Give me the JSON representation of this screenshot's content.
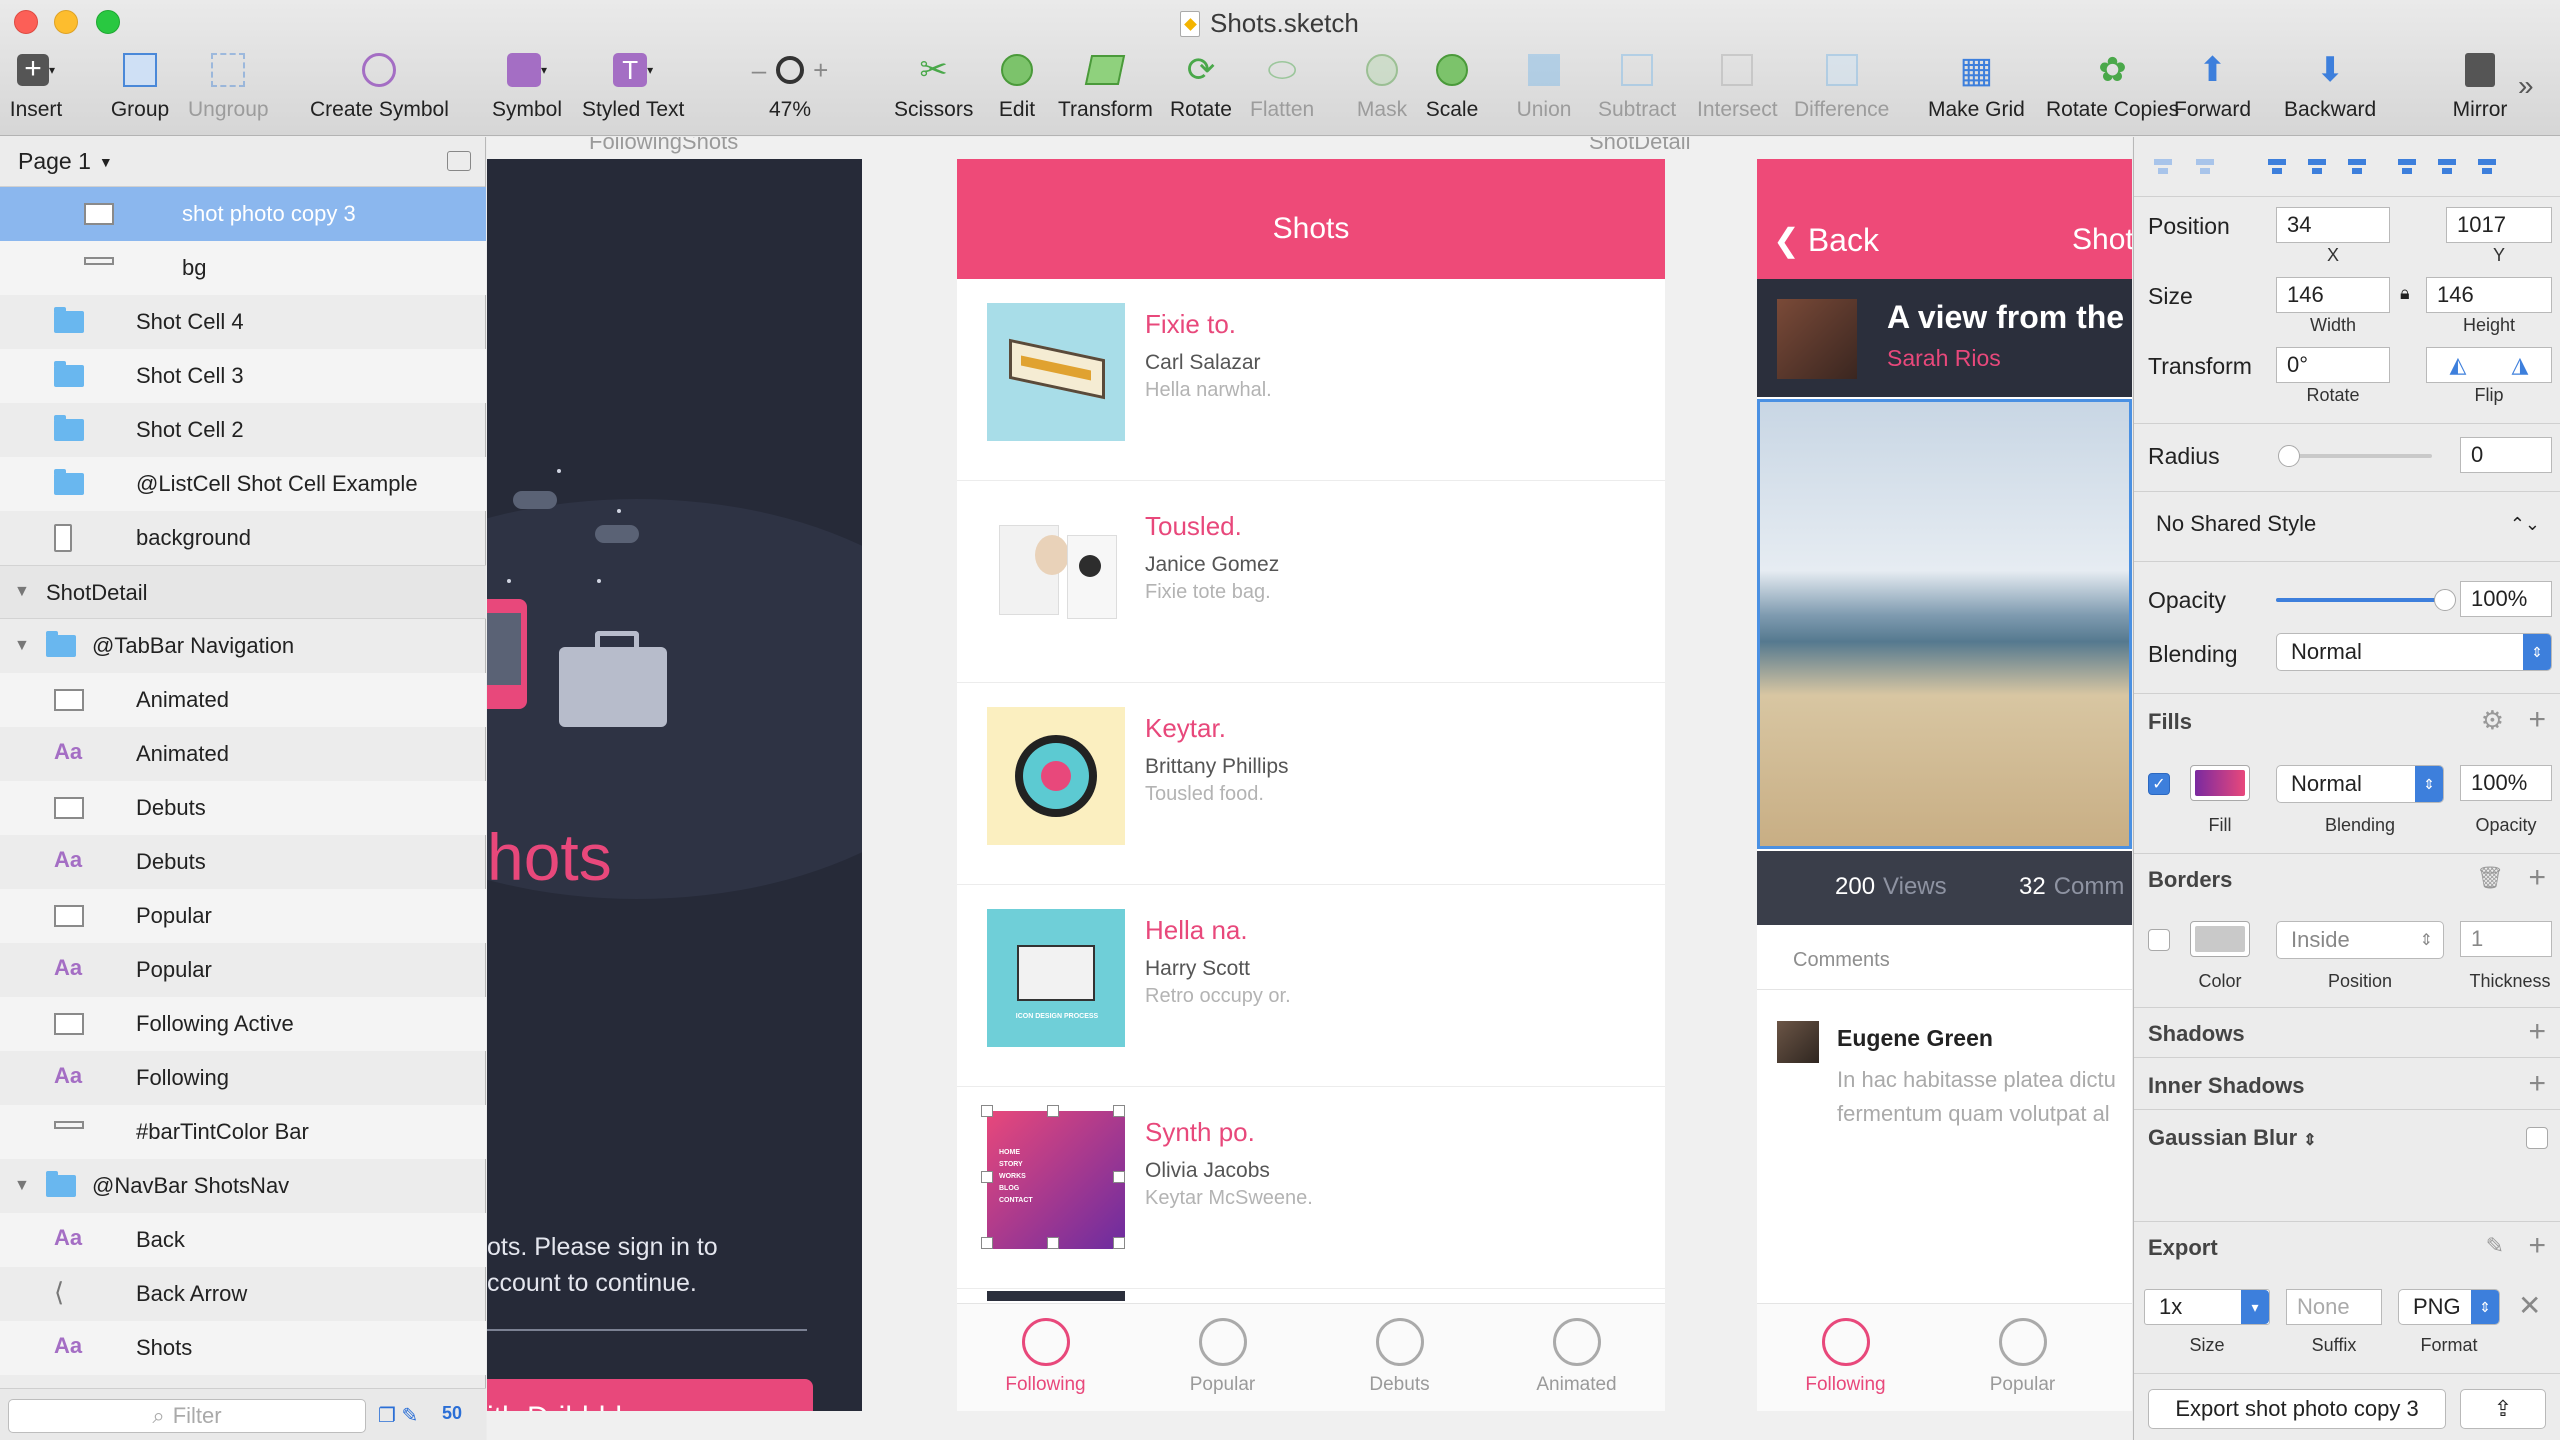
{
  "window": {
    "title": "Shots.sketch"
  },
  "toolbar": {
    "insert": "Insert",
    "group": "Group",
    "ungroup": "Ungroup",
    "create_symbol": "Create Symbol",
    "symbol": "Symbol",
    "styled_text": "Styled Text",
    "zoom": "47%",
    "scissors": "Scissors",
    "edit": "Edit",
    "transform": "Transform",
    "rotate": "Rotate",
    "flatten": "Flatten",
    "mask": "Mask",
    "scale": "Scale",
    "union": "Union",
    "subtract": "Subtract",
    "intersect": "Intersect",
    "difference": "Difference",
    "make_grid": "Make Grid",
    "rotate_copies": "Rotate Copies",
    "forward": "Forward",
    "backward": "Backward",
    "mirror": "Mirror"
  },
  "layers": {
    "page": "Page 1",
    "items": [
      {
        "name": "shot photo copy 3",
        "kind": "image",
        "indent": 2,
        "selected": true
      },
      {
        "name": "bg",
        "kind": "rect",
        "indent": 2
      },
      {
        "name": "Shot Cell 4",
        "kind": "folder",
        "indent": 1,
        "collapsed": true
      },
      {
        "name": "Shot Cell 3",
        "kind": "folder",
        "indent": 1,
        "collapsed": true
      },
      {
        "name": "Shot Cell 2",
        "kind": "folder",
        "indent": 1,
        "collapsed": true
      },
      {
        "name": "@ListCell Shot Cell Example",
        "kind": "folder",
        "indent": 1,
        "collapsed": true
      },
      {
        "name": "background",
        "kind": "artboard-bg",
        "indent": 1
      },
      {
        "name": "ShotDetail",
        "kind": "artboard",
        "indent": 0,
        "expanded": true
      },
      {
        "name": "@TabBar Navigation",
        "kind": "folder",
        "indent": 0,
        "expanded": true
      },
      {
        "name": "Animated",
        "kind": "image",
        "indent": 1
      },
      {
        "name": "Animated",
        "kind": "text",
        "indent": 1
      },
      {
        "name": "Debuts",
        "kind": "image",
        "indent": 1
      },
      {
        "name": "Debuts",
        "kind": "text",
        "indent": 1
      },
      {
        "name": "Popular",
        "kind": "image",
        "indent": 1
      },
      {
        "name": "Popular",
        "kind": "text",
        "indent": 1
      },
      {
        "name": "Following Active",
        "kind": "image",
        "indent": 1
      },
      {
        "name": "Following",
        "kind": "text",
        "indent": 1
      },
      {
        "name": "#barTintColor Bar",
        "kind": "rect",
        "indent": 1
      },
      {
        "name": "@NavBar ShotsNav",
        "kind": "folder",
        "indent": 0,
        "expanded": true
      },
      {
        "name": "Back",
        "kind": "text",
        "indent": 1
      },
      {
        "name": "Back Arrow",
        "kind": "path",
        "indent": 1
      },
      {
        "name": "Shots",
        "kind": "text",
        "indent": 1
      }
    ],
    "filter_placeholder": "Filter",
    "filter_count": "50"
  },
  "canvas": {
    "login": {
      "title": "hots",
      "text_line1": "ots. Please sign in to",
      "text_line2": "ccount to continue.",
      "button": "ith Dribbble"
    },
    "shots_artboard": {
      "label": "FollowingShots",
      "nav_title": "Shots",
      "cells": [
        {
          "title": "Fixie to.",
          "author": "Carl Salazar",
          "desc": "Hella narwhal.",
          "thumb": "cassette"
        },
        {
          "title": "Tousled.",
          "author": "Janice Gomez",
          "desc": "Fixie tote bag.",
          "thumb": "web-mockup"
        },
        {
          "title": "Keytar.",
          "author": "Brittany Phillips",
          "desc": "Tousled food.",
          "thumb": "record"
        },
        {
          "title": "Hella na.",
          "author": "Harry Scott",
          "desc": "Retro occupy or.",
          "thumb": "icon-design-process"
        },
        {
          "title": "Synth po.",
          "author": "Olivia Jacobs",
          "desc": "Keytar McSweene.",
          "thumb": "purple-site"
        }
      ],
      "thumb_text": {
        "icon_design": "ICON DESIGN PROCESS",
        "purple_menu": [
          "HOME",
          "STORY",
          "WORKS",
          "BLOG",
          "CONTACT"
        ]
      },
      "tabs": [
        {
          "label": "Following",
          "active": true
        },
        {
          "label": "Popular"
        },
        {
          "label": "Debuts"
        },
        {
          "label": "Animated"
        }
      ]
    },
    "detail_artboard": {
      "label": "ShotDetail",
      "back": "Back",
      "nav_title": "Shot",
      "title": "A view from the I",
      "author": "Sarah Rios",
      "views_count": "200",
      "views_label": "Views",
      "comments_count": "32",
      "comments_label": "Comm",
      "comments_header": "Comments",
      "commenter": "Eugene Green",
      "comment_line1": "In hac habitasse platea dictu",
      "comment_line2": "fermentum quam volutpat al",
      "tabs": [
        {
          "label": "Following",
          "active": true
        },
        {
          "label": "Popular"
        }
      ]
    }
  },
  "inspector": {
    "position_label": "Position",
    "x": "34",
    "y": "1017",
    "x_label": "X",
    "y_label": "Y",
    "size_label": "Size",
    "width": "146",
    "height": "146",
    "width_label": "Width",
    "height_label": "Height",
    "transform_label": "Transform",
    "rotate": "0°",
    "rotate_label": "Rotate",
    "flip_label": "Flip",
    "radius_label": "Radius",
    "radius": "0",
    "shared_style": "No Shared Style",
    "opacity_label": "Opacity",
    "opacity": "100%",
    "opacity_fraction": 1.0,
    "blending_label": "Blending",
    "blending": "Normal",
    "fills_title": "Fills",
    "fill_enabled": true,
    "fill_blending": "Normal",
    "fill_opacity": "100%",
    "fill_label": "Fill",
    "fill_blend_label": "Blending",
    "fill_opacity_label": "Opacity",
    "borders_title": "Borders",
    "border_enabled": false,
    "border_position": "Inside",
    "border_thickness": "1",
    "border_color_label": "Color",
    "border_position_label": "Position",
    "border_thickness_label": "Thickness",
    "shadows_title": "Shadows",
    "inner_shadows_title": "Inner Shadows",
    "gaussian_blur_title": "Gaussian Blur",
    "export_title": "Export",
    "export_size": "1x",
    "export_suffix_placeholder": "None",
    "export_format": "PNG",
    "export_size_label": "Size",
    "export_suffix_label": "Suffix",
    "export_format_label": "Format",
    "export_button": "Export shot photo copy 3"
  },
  "colors": {
    "accent_pink": "#ee4a78",
    "selection_blue": "#8bb7ee",
    "control_blue": "#3d7fdc",
    "dark_bg": "#262a38"
  }
}
